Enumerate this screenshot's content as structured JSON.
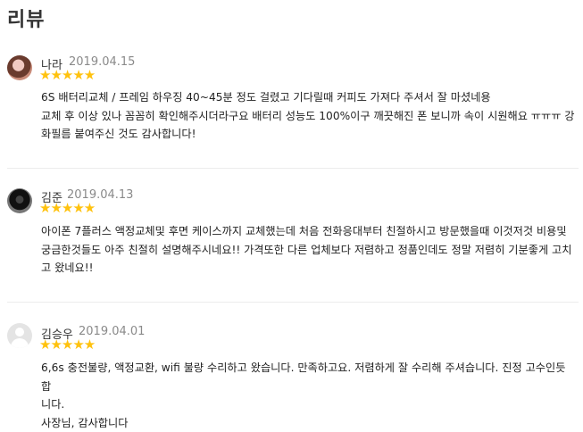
{
  "page": {
    "title": "리뷰"
  },
  "reviews": [
    {
      "author": "나라",
      "date": "2019.04.15",
      "stars": "★★★★★",
      "rating": 5,
      "text": "6S 배터리교체 / 프레임 하우징 40~45분 정도 걸렸고 기다릴때 커피도 가져다 주셔서 잘 마셨네용\n교체 후 이상 있나 꼼꼼히 확인해주시더라구요 배터리 성능도 100%이구 깨끗해진 폰 보니까 속이 시원해요 ㅠㅠㅠ 강\n화필름 붙여주신 것도 감사합니다!"
    },
    {
      "author": "김준",
      "date": "2019.04.13",
      "stars": "★★★★★",
      "rating": 5,
      "text": "아이폰 7플러스 액정교체및 후면 케이스까지 교체했는데 처음 전화응대부터 친절하시고 방문했을때 이것저것 비용및\n궁금한것들도 아주 친절히 설명해주시네요!! 가격또한 다른 업체보다 저렴하고 정품인데도 정말 저렴히 기분좋게 고치\n고 왔네요!!"
    },
    {
      "author": "김승우",
      "date": "2019.04.01",
      "stars": "★★★★★",
      "rating": 5,
      "text": "6,6s 충전불량, 액정교환, wifi 불량 수리하고 왔습니다. 만족하고요. 저렴하게 잘 수리해 주셔습니다. 진정 고수인듯 합\n니다.\n사장님, 감사합니다"
    }
  ]
}
